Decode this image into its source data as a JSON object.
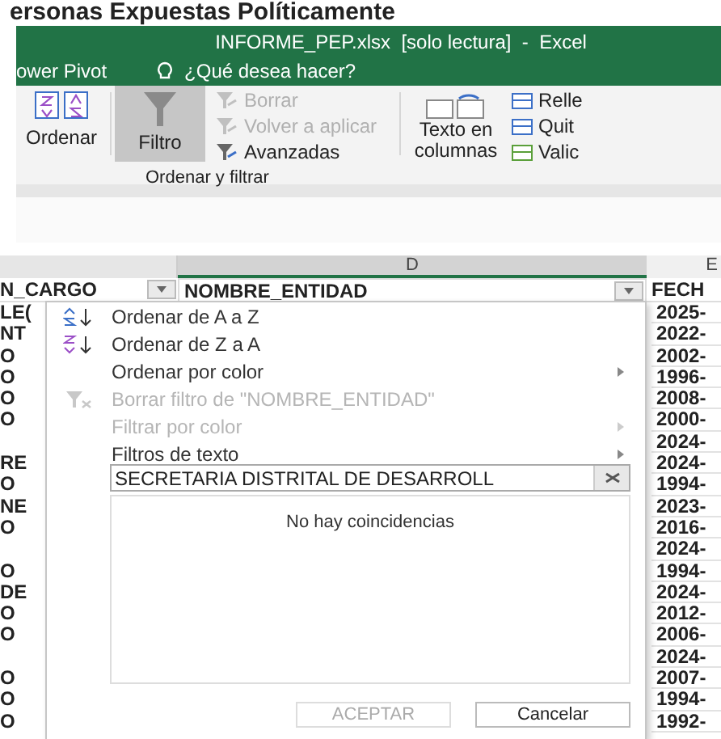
{
  "page_heading": "ersonas Expuestas Políticamente",
  "window": {
    "title": "INFORME_PEP.xlsx  [solo lectura]  -  Excel"
  },
  "ribbon_tabs": [
    {
      "label": "ower Pivot"
    }
  ],
  "tell_me": {
    "placeholder": "¿Qué desea hacer?"
  },
  "ribbon": {
    "sort_button": {
      "label": "Ordenar"
    },
    "filter_button": {
      "label": "Filtro",
      "selected": true
    },
    "small_buttons": [
      {
        "label": "Borrar",
        "disabled": true
      },
      {
        "label": "Volver a aplicar",
        "disabled": true
      },
      {
        "label": "Avanzadas",
        "disabled": false
      }
    ],
    "group_label": "Ordenar y filtrar",
    "text_to_columns": {
      "label": "Texto en columnas"
    },
    "tools": [
      {
        "label": "Relle"
      },
      {
        "label": "Quit"
      },
      {
        "label": "Valic"
      }
    ]
  },
  "columns": [
    {
      "letter": "D"
    },
    {
      "letter": "E"
    }
  ],
  "headers": [
    {
      "text": "N_CARGO",
      "filter": true
    },
    {
      "text": "NOMBRE_ENTIDAD",
      "filter": true
    },
    {
      "text": "FECH",
      "filter": false
    }
  ],
  "rows": [
    {
      "column_1": "LE(",
      "column_3": "2025-"
    },
    {
      "column_1": "NT",
      "column_3": "2022-"
    },
    {
      "column_1": "O",
      "column_3": "2002-"
    },
    {
      "column_1": "O",
      "column_3": "1996-"
    },
    {
      "column_1": "O",
      "column_3": "2008-"
    },
    {
      "column_1": "O",
      "column_3": "2000-"
    },
    {
      "column_1": "",
      "column_3": "2024-"
    },
    {
      "column_1": "RE",
      "column_3": "2024-"
    },
    {
      "column_1": "O",
      "column_3": "1994-"
    },
    {
      "column_1": "NE",
      "column_3": "2023-"
    },
    {
      "column_1": "O",
      "column_3": "2016-"
    },
    {
      "column_1": "",
      "column_3": "2024-"
    },
    {
      "column_1": "O",
      "column_3": "1994-"
    },
    {
      "column_1": "DE",
      "column_3": "2024-"
    },
    {
      "column_1": "O",
      "column_3": "2012-"
    },
    {
      "column_1": "O",
      "column_3": "2006-"
    },
    {
      "column_1": "",
      "column_3": "2024-"
    },
    {
      "column_1": "O",
      "column_3": "2007-"
    },
    {
      "column_1": "O",
      "column_3": "1994-"
    },
    {
      "column_1": "O",
      "column_3": "1992-"
    }
  ],
  "filter_menu": {
    "items": [
      {
        "label": "Ordenar de A a Z",
        "kind": "ascending",
        "disabled": false,
        "submenu": false
      },
      {
        "label": "Ordenar de Z a A",
        "kind": "descending",
        "disabled": false,
        "submenu": false
      },
      {
        "label": "Ordenar por color",
        "kind": "plain",
        "disabled": false,
        "submenu": true
      },
      {
        "label": "Borrar filtro de \"NOMBRE_ENTIDAD\"",
        "kind": "clear",
        "disabled": true,
        "submenu": false
      },
      {
        "label": "Filtrar por color",
        "kind": "plain",
        "disabled": true,
        "submenu": true
      },
      {
        "label": "Filtros de texto",
        "kind": "plain",
        "disabled": false,
        "submenu": true
      }
    ],
    "search": {
      "value": "SECRETARIA DISTRITAL DE DESARROLL"
    },
    "empty_message": "No hay coincidencias",
    "buttons": [
      {
        "label": "ACEPTAR",
        "disabled": true
      },
      {
        "label": "Cancelar",
        "disabled": false
      }
    ]
  }
}
